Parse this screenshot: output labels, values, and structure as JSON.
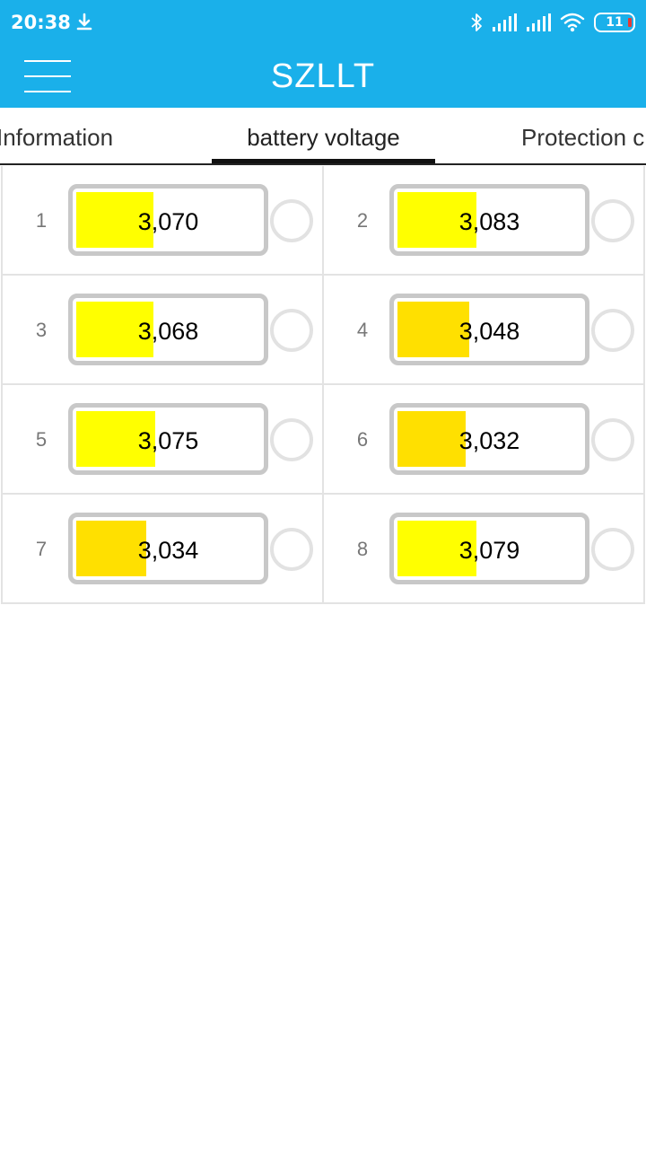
{
  "status_bar": {
    "time": "20:38",
    "battery_level": "11",
    "icons": [
      "download-icon",
      "bluetooth-icon",
      "signal-icon",
      "signal-icon",
      "wifi-icon",
      "battery-icon"
    ]
  },
  "app_bar": {
    "title": "SZLLT",
    "menu_icon": "hamburger-menu-icon"
  },
  "tabs": [
    {
      "label": "Information",
      "active": false
    },
    {
      "label": "battery voltage",
      "active": true
    },
    {
      "label": "Protection c",
      "active": false
    }
  ],
  "cells": [
    {
      "index": "1",
      "value": "3,070",
      "fill_fraction": 0.42,
      "color": "#ffff00"
    },
    {
      "index": "2",
      "value": "3,083",
      "fill_fraction": 0.43,
      "color": "#ffff00"
    },
    {
      "index": "3",
      "value": "3,068",
      "fill_fraction": 0.42,
      "color": "#ffff00"
    },
    {
      "index": "4",
      "value": "3,048",
      "fill_fraction": 0.39,
      "color": "#ffe000"
    },
    {
      "index": "5",
      "value": "3,075",
      "fill_fraction": 0.43,
      "color": "#ffff00"
    },
    {
      "index": "6",
      "value": "3,032",
      "fill_fraction": 0.37,
      "color": "#ffe000"
    },
    {
      "index": "7",
      "value": "3,034",
      "fill_fraction": 0.38,
      "color": "#ffe000"
    },
    {
      "index": "8",
      "value": "3,079",
      "fill_fraction": 0.43,
      "color": "#ffff00"
    }
  ],
  "colors": {
    "primary": "#1ab0ea",
    "cell_full": "#ffff00",
    "cell_low": "#ffe000",
    "border": "#c8c8c8"
  }
}
